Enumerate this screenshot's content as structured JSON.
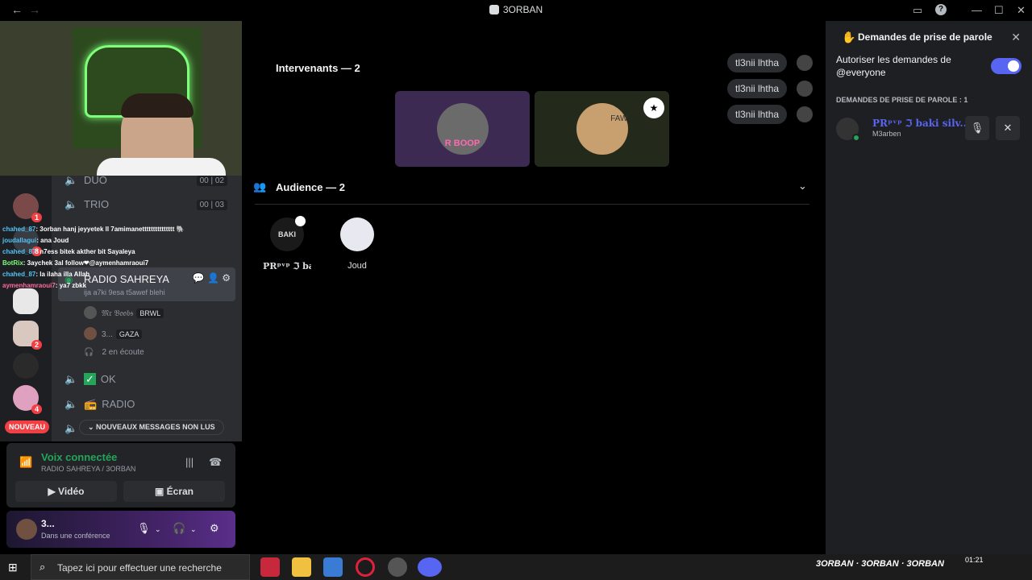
{
  "titlebar": {
    "title": "3ORBAN",
    "back": "←",
    "forward": "→",
    "inbox_icon": "inbox-icon",
    "help": "?",
    "minimize": "—",
    "maximize": "☐",
    "close": "✕"
  },
  "servers": {
    "badges": [
      "1",
      "8",
      "2",
      "4"
    ],
    "nouveau": "NOUVEAU"
  },
  "channels": {
    "duo": {
      "name": "DUO",
      "count_a": "00",
      "count_b": "02"
    },
    "trio": {
      "name": "TRIO",
      "count_a": "00",
      "count_b": "03"
    },
    "radio": {
      "name": "RADIO SAHREYA",
      "topic": "ija a7ki 9esa t5awef blehi"
    },
    "members": [
      {
        "name": "𝔐𝔯 𝔅𝔬𝔬𝔟𝔰",
        "tag": "BRWL"
      },
      {
        "name": "3...",
        "tag": "GAZA"
      }
    ],
    "listening": "2 en écoute",
    "ok": "OK",
    "radio2": "RADIO",
    "new_messages": "NOUVEAUX MESSAGES NON LUS"
  },
  "chat_overlay": [
    {
      "user": "chahed_87",
      "text": ": 3orban hanj jeyyetek ll 7amimanettttttttttttttt 🐘"
    },
    {
      "user": "joudallagui",
      "text": ": ana Joud"
    },
    {
      "user": "chahed_87",
      "text": ": n7ess bitek akther bit Sayaleya"
    },
    {
      "user": "BotRix",
      "text": ": 3aychek 3al follow❤@aymenhamraoui7"
    },
    {
      "user": "chahed_87",
      "text": ": la ilaha illa Allah"
    },
    {
      "user": "aymenhamraoui7",
      "text": ": ya7 zbkk"
    }
  ],
  "voice": {
    "status": "Voix connectée",
    "location": "RADIO SAHREYA / 3ORBAN",
    "video": "Vidéo",
    "screen": "Écran"
  },
  "user": {
    "name": "3...",
    "status": "Dans une conférence"
  },
  "stage": {
    "speakers_title": "Intervenants — 2",
    "audience_title": "Audience — 2",
    "speaker_tiles": [
      {
        "label": "R BOOP",
        "color": "#3d2a52"
      },
      {
        "label": "FAW",
        "color": "#232a1c"
      }
    ],
    "chips": [
      "tl3nii lhtha",
      "tl3nii lhtha",
      "tl3nii lhtha"
    ],
    "audience": [
      {
        "name": "PRᵖᵛᵖ ℑ baki ...",
        "avatar_text": "BAKI"
      },
      {
        "name": "Joud"
      }
    ]
  },
  "rpanel": {
    "title": "Demandes de prise de parole",
    "allow": "Autoriser les demandes de @everyone",
    "section": "DEMANDES DE PRISE DE PAROLE : 1",
    "request": {
      "name": "PRᵖᵛᵖ ℑ baki silv...",
      "sub": "M3arben"
    }
  },
  "taskbar": {
    "search_placeholder": "Tapez ici pour effectuer une recherche",
    "tray_text": "3ORBAN",
    "time": "01:21"
  },
  "colors": {
    "accent": "#5865f2",
    "online": "#23a55a",
    "danger": "#f23f43"
  }
}
